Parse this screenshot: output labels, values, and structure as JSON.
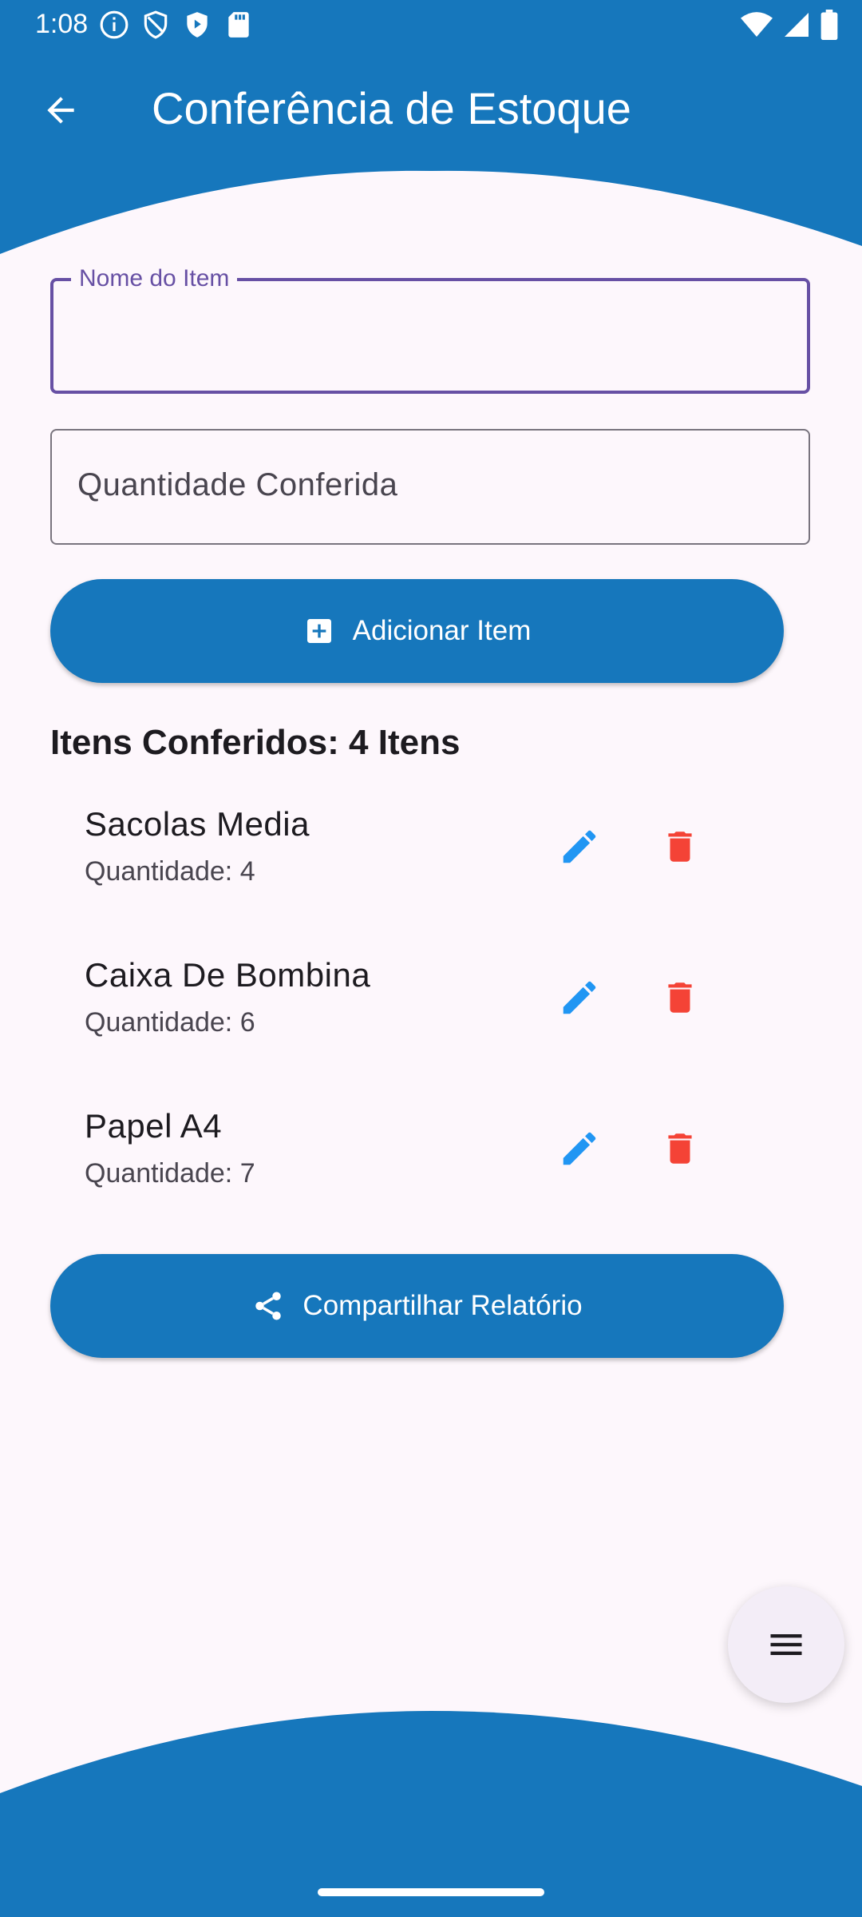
{
  "colors": {
    "primary": "#1677BC",
    "focus": "#6750A4",
    "edit": "#2196F3",
    "delete": "#F44336",
    "background": "#FDF7FC"
  },
  "status_bar": {
    "time": "1:08",
    "left_icons": [
      "info-icon",
      "shield-icon",
      "play-shield-icon",
      "sd-card-icon"
    ],
    "right_icons": [
      "wifi-icon",
      "signal-icon",
      "battery-icon"
    ]
  },
  "app_bar": {
    "title": "Conferência de Estoque",
    "back_icon": "arrow-left-icon"
  },
  "form": {
    "name_label": "Nome do Item",
    "name_value": "",
    "quantity_placeholder": "Quantidade Conferida",
    "add_button_label": "Adicionar Item",
    "add_icon": "add-box-icon"
  },
  "list": {
    "title": "Itens Conferidos: 4 Itens",
    "items": [
      {
        "name": "Sacolas Media",
        "quantity": "Quantidade: 4"
      },
      {
        "name": "Caixa De Bombina",
        "quantity": "Quantidade: 6"
      },
      {
        "name": "Papel A4",
        "quantity": "Quantidade: 7"
      }
    ]
  },
  "share_button_label": "Compartilhar Relatório",
  "share_icon": "share-icon",
  "fab_icon": "menu-icon"
}
